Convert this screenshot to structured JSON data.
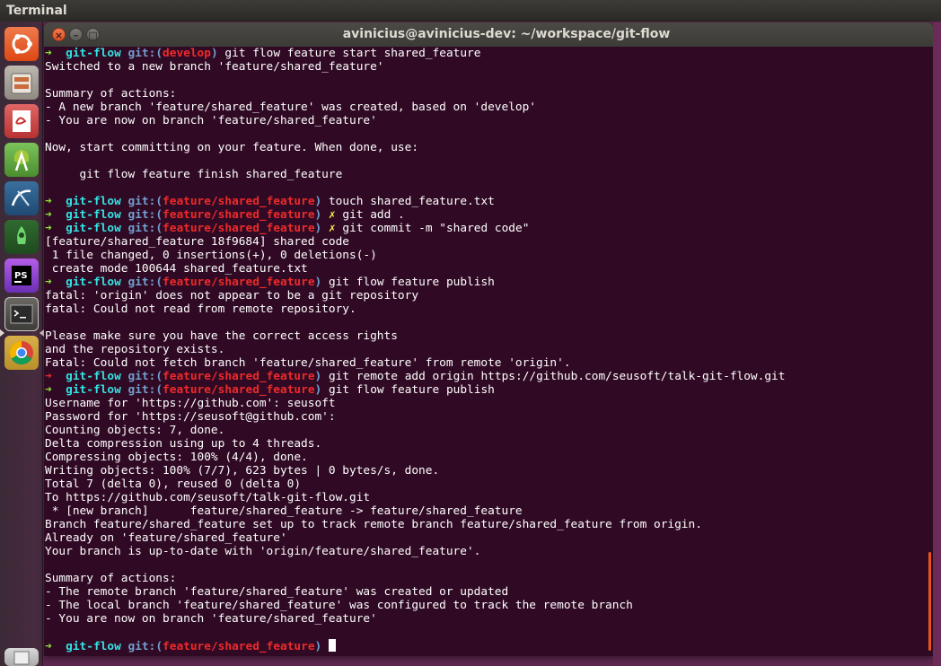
{
  "panel": {
    "app_name": "Terminal"
  },
  "window": {
    "title": "avinicius@avinicius-dev: ~/workspace/git-flow"
  },
  "launcher": {
    "items": [
      {
        "name": "ubuntu-dash-icon",
        "color": "#e95420"
      },
      {
        "name": "files-icon",
        "color": "#a9a39a"
      },
      {
        "name": "text-editor-icon",
        "color": "#d43f3f"
      },
      {
        "name": "android-studio-icon",
        "color": "#6ab344"
      },
      {
        "name": "mysql-workbench-icon",
        "color": "#2b5d8a"
      },
      {
        "name": "rocket-app-icon",
        "color": "#3d7d3d"
      },
      {
        "name": "phpstorm-icon",
        "color": "#8b3fd9"
      },
      {
        "name": "terminal-icon",
        "color": "#2c2c2c"
      },
      {
        "name": "chrome-icon",
        "color": "#4285f4"
      },
      {
        "name": "trash-icon",
        "color": "#cfcfcf"
      }
    ]
  },
  "prompt": {
    "arrow": "➜",
    "dir": "git-flow",
    "git_open": "git:(",
    "git_close": ")",
    "dirty_mark": "✗"
  },
  "terminal": {
    "lines": [
      {
        "type": "prompt",
        "branch": "develop",
        "dirty": false,
        "cmd": "git flow feature start shared_feature"
      },
      {
        "type": "out",
        "text": "Switched to a new branch 'feature/shared_feature'"
      },
      {
        "type": "out",
        "text": ""
      },
      {
        "type": "out",
        "text": "Summary of actions:"
      },
      {
        "type": "out",
        "text": "- A new branch 'feature/shared_feature' was created, based on 'develop'"
      },
      {
        "type": "out",
        "text": "- You are now on branch 'feature/shared_feature'"
      },
      {
        "type": "out",
        "text": ""
      },
      {
        "type": "out",
        "text": "Now, start committing on your feature. When done, use:"
      },
      {
        "type": "out",
        "text": ""
      },
      {
        "type": "out",
        "text": "     git flow feature finish shared_feature"
      },
      {
        "type": "out",
        "text": ""
      },
      {
        "type": "prompt",
        "branch": "feature/shared_feature",
        "dirty": false,
        "cmd": "touch shared_feature.txt"
      },
      {
        "type": "prompt",
        "branch": "feature/shared_feature",
        "dirty": true,
        "cmd": "git add ."
      },
      {
        "type": "prompt",
        "branch": "feature/shared_feature",
        "dirty": true,
        "cmd": "git commit -m \"shared code\""
      },
      {
        "type": "out",
        "text": "[feature/shared_feature 18f9684] shared code"
      },
      {
        "type": "out",
        "text": " 1 file changed, 0 insertions(+), 0 deletions(-)"
      },
      {
        "type": "out",
        "text": " create mode 100644 shared_feature.txt"
      },
      {
        "type": "prompt",
        "branch": "feature/shared_feature",
        "dirty": false,
        "cmd": "git flow feature publish"
      },
      {
        "type": "out",
        "text": "fatal: 'origin' does not appear to be a git repository"
      },
      {
        "type": "out",
        "text": "fatal: Could not read from remote repository."
      },
      {
        "type": "out",
        "text": ""
      },
      {
        "type": "out",
        "text": "Please make sure you have the correct access rights"
      },
      {
        "type": "out",
        "text": "and the repository exists."
      },
      {
        "type": "out",
        "text": "Fatal: Could not fetch branch 'feature/shared_feature' from remote 'origin'."
      },
      {
        "type": "prompt",
        "branch": "feature/shared_feature",
        "dirty": false,
        "failed": true,
        "cmd": "git remote add origin https://github.com/seusoft/talk-git-flow.git"
      },
      {
        "type": "prompt",
        "branch": "feature/shared_feature",
        "dirty": false,
        "cmd": "git flow feature publish"
      },
      {
        "type": "out",
        "text": "Username for 'https://github.com': seusoft"
      },
      {
        "type": "out",
        "text": "Password for 'https://seusoft@github.com':"
      },
      {
        "type": "out",
        "text": "Counting objects: 7, done."
      },
      {
        "type": "out",
        "text": "Delta compression using up to 4 threads."
      },
      {
        "type": "out",
        "text": "Compressing objects: 100% (4/4), done."
      },
      {
        "type": "out",
        "text": "Writing objects: 100% (7/7), 623 bytes | 0 bytes/s, done."
      },
      {
        "type": "out",
        "text": "Total 7 (delta 0), reused 0 (delta 0)"
      },
      {
        "type": "out",
        "text": "To https://github.com/seusoft/talk-git-flow.git"
      },
      {
        "type": "out",
        "text": " * [new branch]      feature/shared_feature -> feature/shared_feature"
      },
      {
        "type": "out",
        "text": "Branch feature/shared_feature set up to track remote branch feature/shared_feature from origin."
      },
      {
        "type": "out",
        "text": "Already on 'feature/shared_feature'"
      },
      {
        "type": "out",
        "text": "Your branch is up-to-date with 'origin/feature/shared_feature'."
      },
      {
        "type": "out",
        "text": ""
      },
      {
        "type": "out",
        "text": "Summary of actions:"
      },
      {
        "type": "out",
        "text": "- The remote branch 'feature/shared_feature' was created or updated"
      },
      {
        "type": "out",
        "text": "- The local branch 'feature/shared_feature' was configured to track the remote branch"
      },
      {
        "type": "out",
        "text": "- You are now on branch 'feature/shared_feature'"
      },
      {
        "type": "out",
        "text": ""
      },
      {
        "type": "prompt",
        "branch": "feature/shared_feature",
        "dirty": false,
        "cmd": "",
        "cursor": true
      }
    ]
  }
}
